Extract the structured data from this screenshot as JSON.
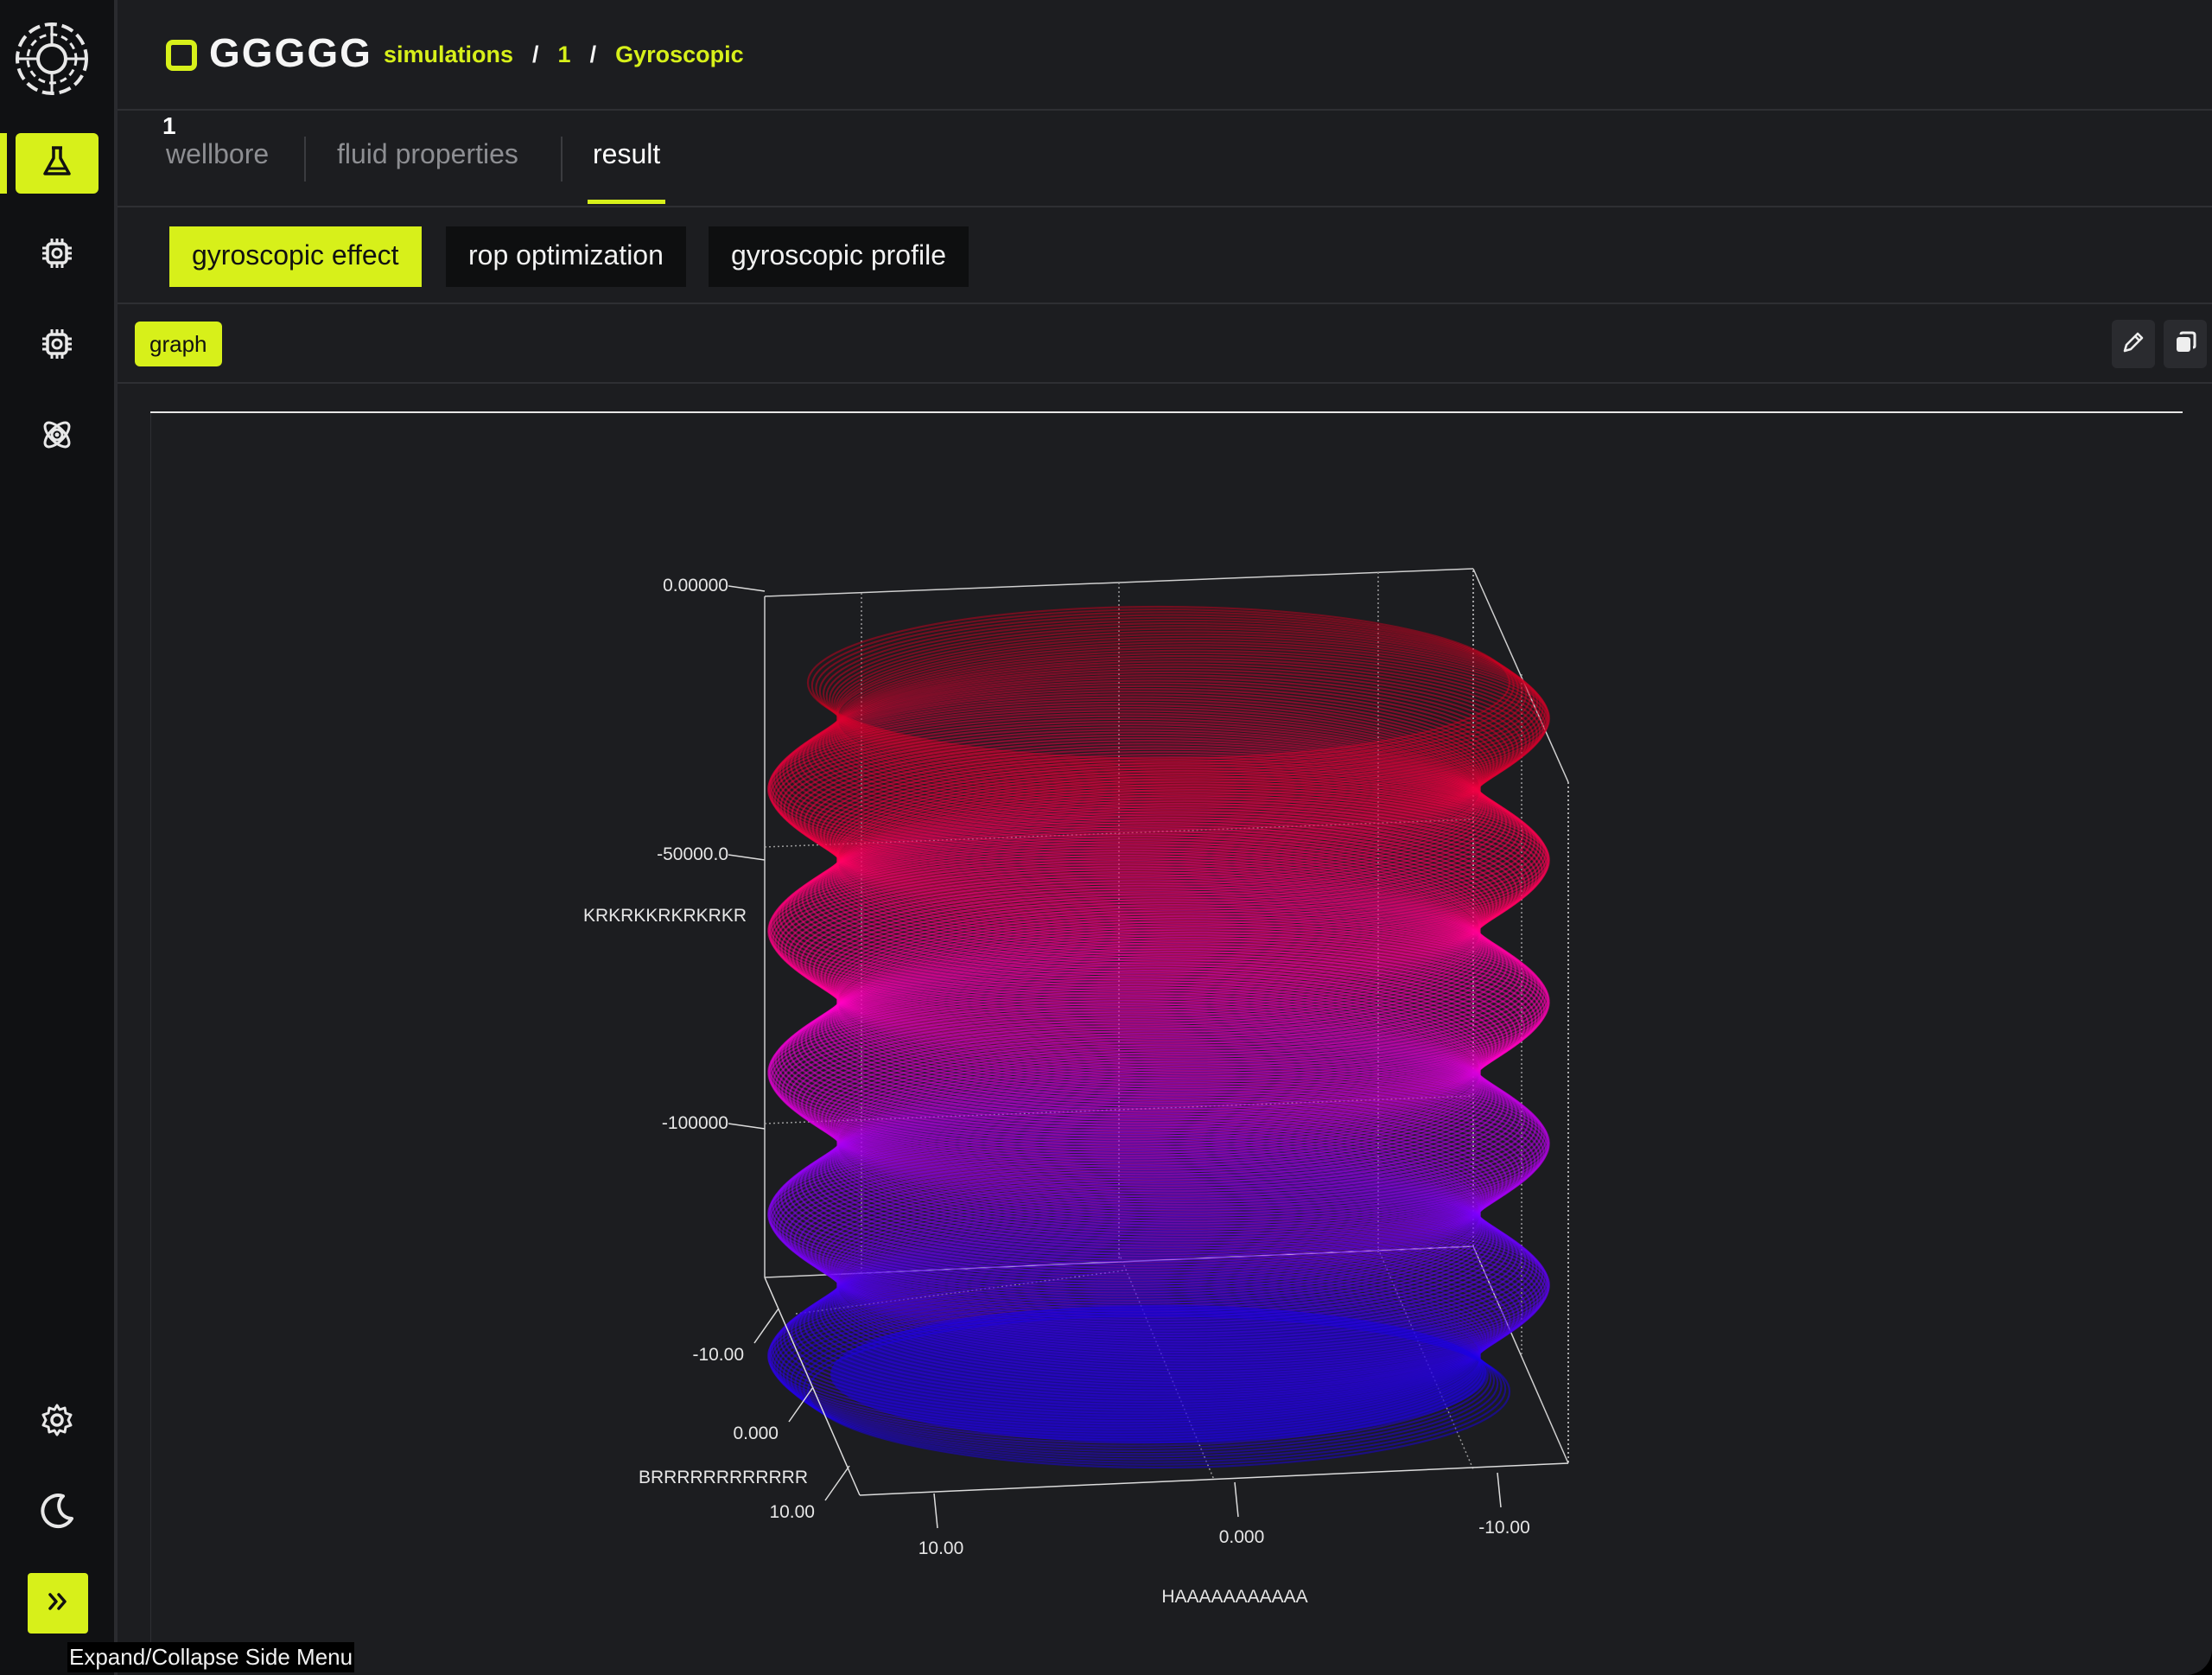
{
  "app": {
    "brand": "GGGGG",
    "breadcrumbs": [
      "simulations",
      "1",
      "Gyroscopic"
    ],
    "breadcrumb_separator": "/"
  },
  "sidebar": {
    "items": [
      {
        "icon": "flask-icon",
        "active": true
      },
      {
        "icon": "chip-icon",
        "active": false
      },
      {
        "icon": "chip-icon",
        "active": false
      },
      {
        "icon": "atom-icon",
        "active": false
      }
    ],
    "bottom_items": [
      {
        "icon": "gear-icon"
      },
      {
        "icon": "moon-icon"
      }
    ],
    "expand_icon": "double-chevron-right-icon",
    "expand_tooltip": "Expand/Collapse Side Menu"
  },
  "tabs": {
    "number": "1",
    "items": [
      {
        "label": "wellbore",
        "active": false
      },
      {
        "label": "fluid properties",
        "active": false
      },
      {
        "label": "result",
        "active": true
      }
    ]
  },
  "subtabs": [
    {
      "label": "gyroscopic effect",
      "active": true
    },
    {
      "label": "rop optimization",
      "active": false
    },
    {
      "label": "gyroscopic profile",
      "active": false
    }
  ],
  "toolbar": {
    "view_label": "graph",
    "edit_icon": "pencil-icon",
    "copy_icon": "copy-icon"
  },
  "colors": {
    "accent": "#d7f01a",
    "background": "#1c1d20",
    "sidebar": "#101113",
    "gradient_top": "#c8001e",
    "gradient_mid": "#ff00c8",
    "gradient_bottom": "#1a00e6"
  },
  "chart_data": {
    "type": "scatter3d",
    "description_of_marks": "helical surface of points colored by depth",
    "xlabel": "HAAAAAAAAAAA",
    "ylabel": "BRRRRRRRRRRRR",
    "zlabel": "KRKRKKRKRKRKR",
    "x_ticks": [
      "10.00",
      "0.000",
      "-10.00"
    ],
    "y_ticks": [
      "-10.00",
      "0.000",
      "10.00"
    ],
    "z_ticks": [
      "0.00000",
      "-50000.0",
      "-100000"
    ],
    "x_range": [
      -12,
      12
    ],
    "y_range": [
      -12,
      12
    ],
    "z_range": [
      -130000,
      0
    ],
    "grid": true,
    "bulges": 5,
    "colorscale": [
      "#c8001e",
      "#ff0050",
      "#ff00c8",
      "#8a00ff",
      "#1a00e6"
    ]
  }
}
